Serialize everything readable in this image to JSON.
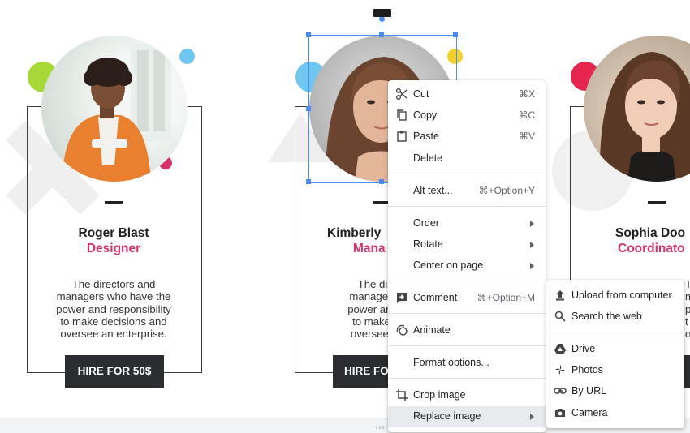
{
  "cards": [
    {
      "name": "Roger Blast",
      "role": "Designer",
      "desc": [
        "The directors and",
        "managers who have the",
        "power and responsibility",
        "to make decisions and",
        "oversee an enterprise."
      ],
      "button": "HIRE FOR 50$"
    },
    {
      "name": "Kimberly",
      "role": "Mana",
      "desc": [
        "The direct",
        "managers wh",
        "power and res",
        "to make dec",
        "oversee an e"
      ],
      "button": "HIRE FO"
    },
    {
      "name": "Sophia Doo",
      "role": "Coordinato",
      "desc": [
        "T",
        "m",
        "p",
        "t",
        "o"
      ],
      "button": ""
    }
  ],
  "context_menu": {
    "items": [
      {
        "label": "Cut",
        "shortcut": "⌘X",
        "icon": "scissors-icon"
      },
      {
        "label": "Copy",
        "shortcut": "⌘C",
        "icon": "copy-icon"
      },
      {
        "label": "Paste",
        "shortcut": "⌘V",
        "icon": "clipboard-icon"
      },
      {
        "label": "Delete",
        "shortcut": "",
        "icon": ""
      },
      {
        "label": "Alt text...",
        "shortcut": "⌘+Option+Y",
        "icon": ""
      },
      {
        "label": "Order",
        "shortcut": "",
        "icon": "",
        "submenu": true
      },
      {
        "label": "Rotate",
        "shortcut": "",
        "icon": "",
        "submenu": true
      },
      {
        "label": "Center on page",
        "shortcut": "",
        "icon": "",
        "submenu": true
      },
      {
        "label": "Comment",
        "shortcut": "⌘+Option+M",
        "icon": "add-comment-icon"
      },
      {
        "label": "Animate",
        "shortcut": "",
        "icon": "animate-icon"
      },
      {
        "label": "Format options...",
        "shortcut": "",
        "icon": ""
      },
      {
        "label": "Crop image",
        "shortcut": "",
        "icon": "crop-icon"
      },
      {
        "label": "Replace image",
        "shortcut": "",
        "icon": "",
        "submenu": true,
        "highlighted": true
      }
    ]
  },
  "submenu": {
    "items": [
      {
        "label": "Upload from computer",
        "icon": "upload-icon"
      },
      {
        "label": "Search the web",
        "icon": "search-icon"
      },
      {
        "label": "Drive",
        "icon": "drive-icon"
      },
      {
        "label": "Photos",
        "icon": "photos-icon"
      },
      {
        "label": "By URL",
        "icon": "link-icon"
      },
      {
        "label": "Camera",
        "icon": "camera-icon"
      }
    ]
  },
  "colors": {
    "accent": "#d6336c",
    "selection": "#4a8bf5",
    "button_bg": "#2b2d31"
  }
}
